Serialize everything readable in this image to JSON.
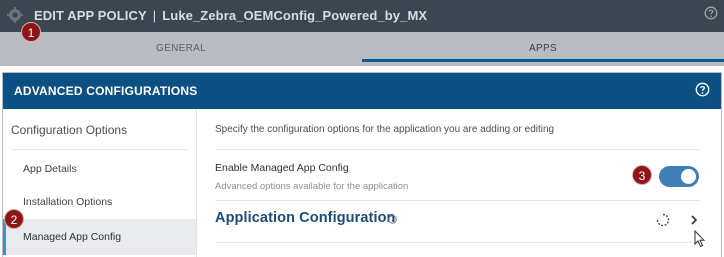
{
  "header": {
    "title": "EDIT APP POLICY",
    "separator": "|",
    "policy_name": "Luke_Zebra_OEMConfig_Powered_by_MX"
  },
  "tabs": [
    {
      "label": "GENERAL",
      "active": false
    },
    {
      "label": "APPS",
      "active": true
    }
  ],
  "modal": {
    "title": "ADVANCED CONFIGURATIONS",
    "sidebar": {
      "heading": "Configuration Options",
      "items": [
        {
          "label": "App Details",
          "active": false
        },
        {
          "label": "Installation Options",
          "active": false
        },
        {
          "label": "Managed App Config",
          "active": true
        }
      ]
    },
    "content": {
      "description": "Specify the configuration options for the application you are adding or editing",
      "toggle_label": "Enable Managed App Config",
      "toggle_help": "Advanced options available for the application",
      "toggle_on": true,
      "section_title": "Application Configuration"
    }
  },
  "annotations": [
    "1",
    "2",
    "3"
  ],
  "colors": {
    "topbar": "#3c4650",
    "modal_header": "#0c4f83",
    "toggle": "#3f7fb5",
    "section_title": "#1d4c7a",
    "badge": "#8f1616",
    "active_marker": "#2a9fb0"
  },
  "icons": {
    "app": "android-gear-icon",
    "help": "help-circle-icon",
    "info": "info-icon",
    "loading": "spinner-icon",
    "expand": "chevron-right-icon"
  }
}
